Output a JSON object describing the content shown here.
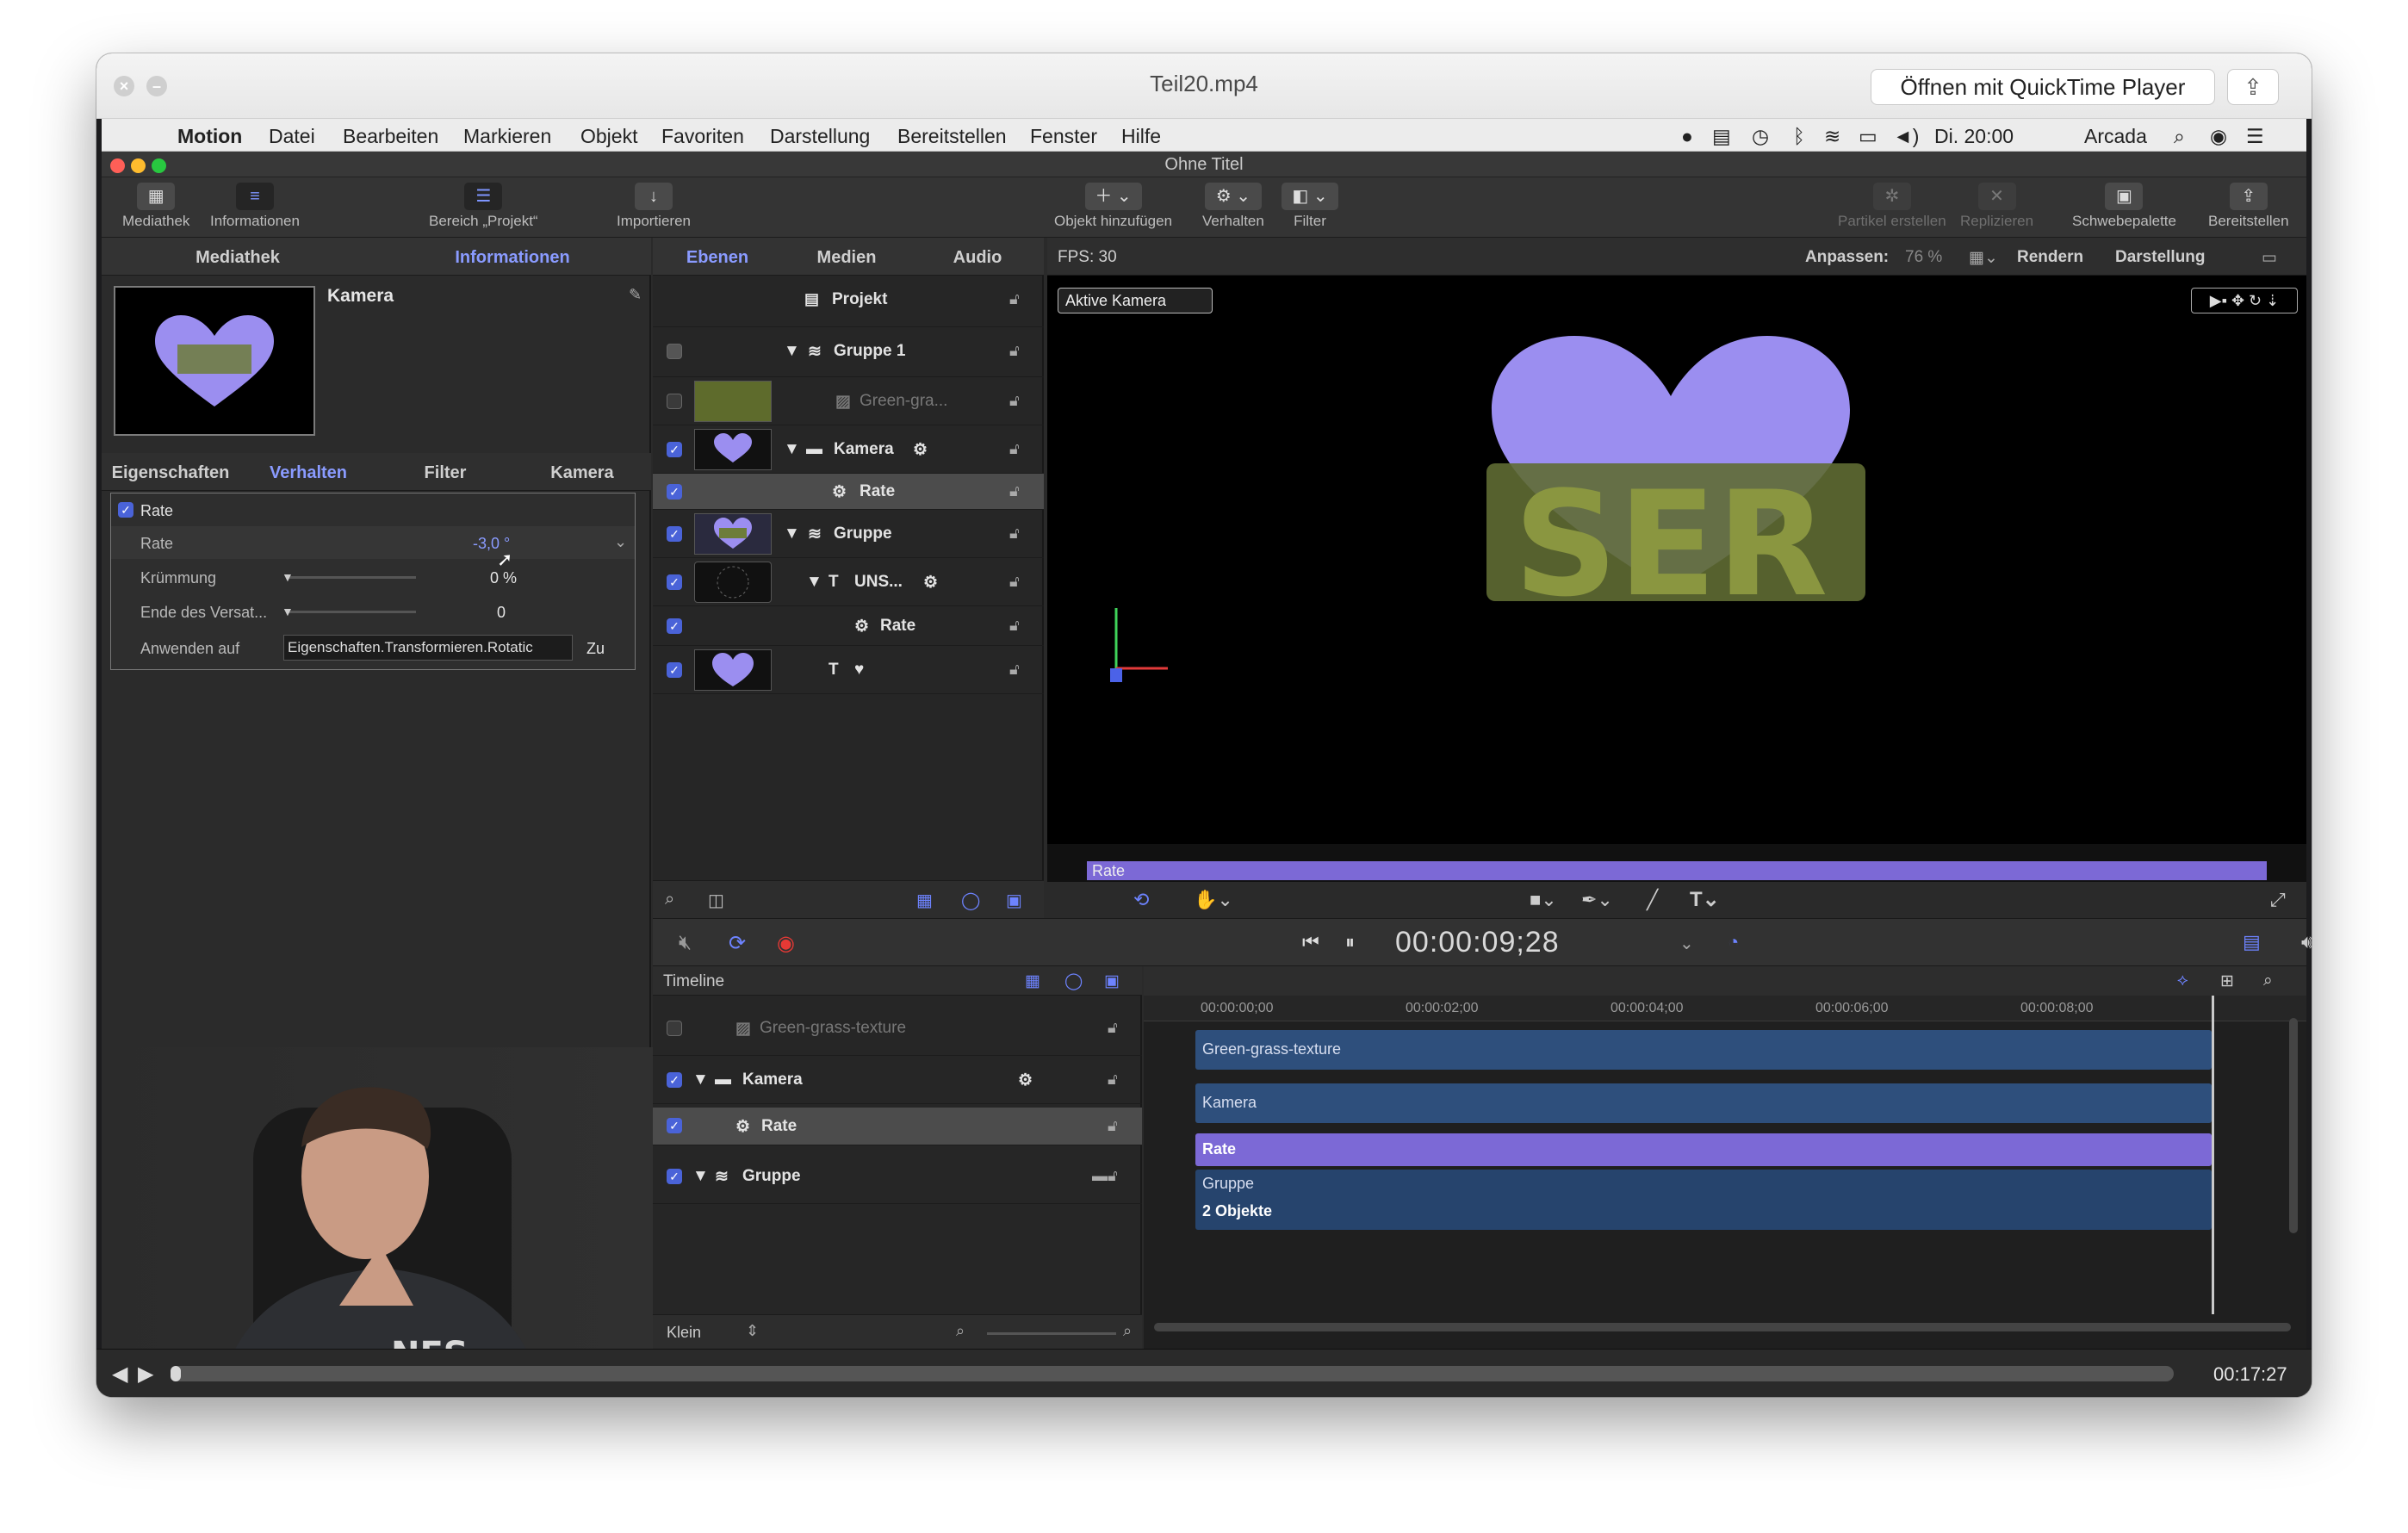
{
  "quicktime": {
    "title": "Teil20.mp4",
    "open_button": "Öffnen mit QuickTime Player",
    "elapsed": "00:17:27",
    "share_icon": "share-icon",
    "progress_fraction": 0.005
  },
  "menubar": {
    "app": "Motion",
    "items": [
      "Datei",
      "Bearbeiten",
      "Markieren",
      "Objekt",
      "Favoriten",
      "Darstellung",
      "Bereitstellen",
      "Fenster",
      "Hilfe"
    ],
    "clock": "Di. 20:00",
    "user": "Arcada"
  },
  "motion": {
    "window_title": "Ohne Titel",
    "toolbar": {
      "mediathek": "Mediathek",
      "informationen": "Informationen",
      "bereich": "Bereich „Projekt“",
      "importieren": "Importieren",
      "objekt_hinzufuegen": "Objekt hinzufügen",
      "verhalten": "Verhalten",
      "filter": "Filter",
      "partikel": "Partikel erstellen",
      "replizieren": "Replizieren",
      "schwebepalette": "Schwebepalette",
      "bereitstellen": "Bereitstellen"
    },
    "left_tabs": [
      "Mediathek",
      "Informationen"
    ],
    "inspector": {
      "object_name": "Kamera",
      "tabs": [
        "Eigenschaften",
        "Verhalten",
        "Filter",
        "Kamera"
      ],
      "behavior_title": "Rate",
      "rows": [
        {
          "label": "Rate",
          "value": "-3,0 °"
        },
        {
          "label": "Krümmung",
          "value": "0 %"
        },
        {
          "label": "Ende des Versat...",
          "value": "0"
        },
        {
          "label": "Anwenden auf",
          "value": "Eigenschaften.Transformieren.Rotatic",
          "extra": "Zu"
        }
      ]
    },
    "layers_tabs": [
      "Ebenen",
      "Medien",
      "Audio"
    ],
    "layers": {
      "project": "Projekt",
      "rows": [
        {
          "name": "Gruppe 1"
        },
        {
          "name": "Green-gra..."
        },
        {
          "name": "Kamera"
        },
        {
          "name": "Rate"
        },
        {
          "name": "Gruppe"
        },
        {
          "name": "UNS..."
        },
        {
          "name": "Rate"
        },
        {
          "name": "♥"
        }
      ]
    },
    "viewer": {
      "fps": "FPS: 30",
      "anpassen": "Anpassen:",
      "zoom": "76 %",
      "rendern": "Rendern",
      "darstellung": "Darstellung",
      "camera_menu": "Aktive Kamera",
      "mini_timeline_label": "Rate"
    },
    "transport": {
      "timecode": "00:00:09;28"
    },
    "timeline": {
      "label": "Timeline",
      "zoom_label": "Klein",
      "ruler": [
        "00:00:00;00",
        "00:00:02;00",
        "00:00:04;00",
        "00:00:06;00",
        "00:00:08;00"
      ],
      "rows": [
        {
          "name": "Green-grass-texture"
        },
        {
          "name": "Kamera"
        },
        {
          "name": "Rate"
        },
        {
          "name": "Gruppe"
        }
      ],
      "bars": {
        "texture": "Green-grass-texture",
        "kamera": "Kamera",
        "rate": "Rate",
        "gruppe": "Gruppe",
        "objekte": "2 Objekte"
      }
    }
  },
  "colors": {
    "accent": "#8a9bff",
    "rate_bar": "#7c69d6",
    "clip_bar": "#2e4f7c",
    "heart": "#9b8ef0"
  }
}
